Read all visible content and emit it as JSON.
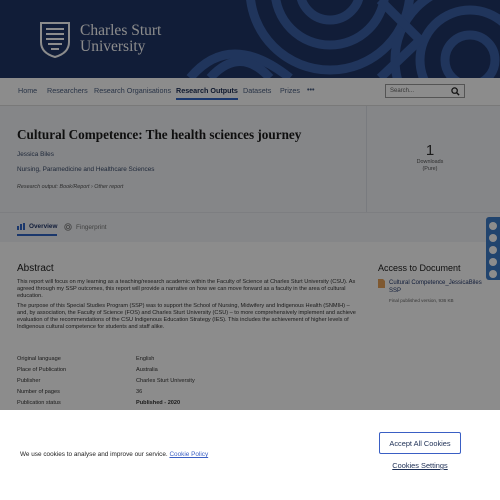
{
  "brand": {
    "line1": "Charles Sturt",
    "line2": "University"
  },
  "nav": {
    "items": [
      "Home",
      "Researchers",
      "Research Organisations",
      "Research Outputs",
      "Datasets",
      "Prizes"
    ],
    "active_index": 3,
    "more_label": "•••",
    "search_placeholder": "Search..."
  },
  "publication": {
    "title": "Cultural Competence: The health sciences journey",
    "author": "Jessica Biles",
    "organisation": "Nursing, Paramedicine and Healthcare Sciences",
    "output_type": "Research output: Book/Report › Other report",
    "downloads": {
      "count": "1",
      "label": "Downloads",
      "source": "(Pure)"
    }
  },
  "tabs": [
    {
      "label": "Overview",
      "active": true,
      "icon": "overview-icon"
    },
    {
      "label": "Fingerprint",
      "active": false,
      "icon": "fingerprint-icon"
    }
  ],
  "abstract": {
    "heading": "Abstract",
    "paragraphs": [
      "This report will focus on my learning as a teaching/research academic within the Faculty of Science at Charles Sturt University (CSU). As agreed through my SSP outcomes, this report will provide a narrative on how we can move forward as a faculty in the area of cultural education.",
      "The purpose of this Special Studies Program (SSP) was to support the School of Nursing, Midwifery and Indigenous Health (SNMIH) – and, by association, the Faculty of Science (FOS) and Charles Sturt University (CSU) – to more comprehensively implement and achieve evaluation of the recommendations of the CSU Indigenous Education Strategy (IES). This includes the achievement of higher levels of Indigenous cultural competence for students and staff alike."
    ]
  },
  "access": {
    "heading": "Access to Document",
    "document_title": "Cultural Competence_JessicaBiles SSP",
    "document_meta": "Final published version, 936 KB"
  },
  "metadata": [
    {
      "key": "Original language",
      "value": "English"
    },
    {
      "key": "Place of Publication",
      "value": "Australia"
    },
    {
      "key": "Publisher",
      "value": "Charles Sturt University"
    },
    {
      "key": "Number of pages",
      "value": "36"
    },
    {
      "key": "Publication status",
      "value": "Published - 2020"
    }
  ],
  "cookie": {
    "text": "We use cookies to analyse and improve our service.",
    "policy_link": "Cookie Policy",
    "accept_label": "Accept All Cookies",
    "settings_label": "Cookies Settings"
  },
  "colors": {
    "banner": "#1f3566",
    "accent": "#3165c5",
    "share_bar": "#3d7cc9"
  }
}
